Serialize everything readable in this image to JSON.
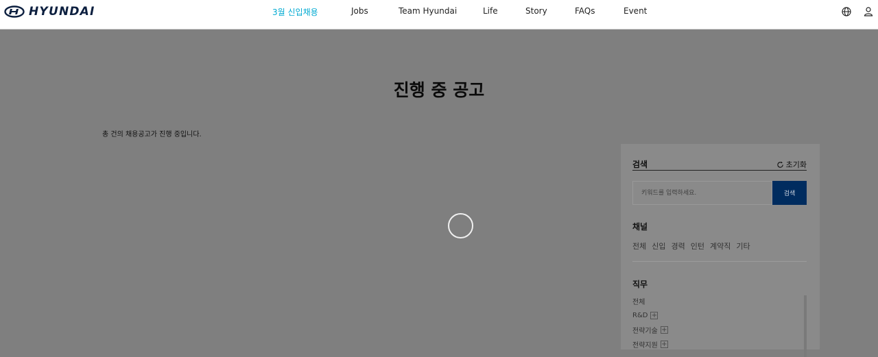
{
  "header": {
    "brand": "HYUNDAI",
    "nav": [
      "3월 신입채용",
      "Jobs",
      "Team Hyundai",
      "Life",
      "Story",
      "FAQs",
      "Event"
    ]
  },
  "main": {
    "title": "진행 중 공고",
    "count_text": "총 건의 채용공고가 진행 중입니다."
  },
  "filter": {
    "header": "검색",
    "reset": "초기화",
    "search_placeholder": "키워드를 입력하세요.",
    "search_button": "검색",
    "channel_title": "채널",
    "channels": [
      "전체",
      "신입",
      "경력",
      "인턴",
      "계약직",
      "기타"
    ],
    "job_title": "직무",
    "jobs": [
      "전체",
      "R&D",
      "전략기술",
      "전략지원"
    ]
  },
  "colors": {
    "accent": "#00aad2",
    "brand_navy": "#002c5f"
  },
  "icons": [
    "hyundai-logo-icon",
    "globe-icon",
    "user-icon",
    "refresh-icon",
    "loading-spinner-icon",
    "plus-icon"
  ]
}
